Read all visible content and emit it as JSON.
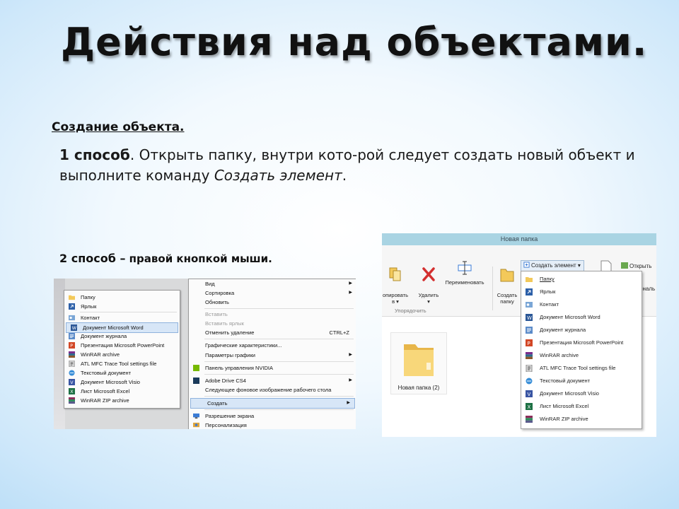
{
  "slide": {
    "title": "Действия над объектами.",
    "subheading": "Создание объекта.",
    "method1": {
      "lead": "1 способ",
      "text_a": ". Открыть папку, внутри кото-рой следует создать новый объект и выполните команду ",
      "emph": "Создать элемент",
      "text_b": "."
    },
    "method2": {
      "lead": "2 способ –",
      "rest": " правой кнопкой мыши."
    }
  },
  "desktop_menu": {
    "submenu_items": [
      {
        "label": "Папку",
        "icon": "folder-icon"
      },
      {
        "label": "Ярлык",
        "icon": "shortcut-icon"
      },
      {
        "label": "Контакт",
        "icon": "contact-icon"
      },
      {
        "label": "Документ Microsoft Word",
        "icon": "word-icon",
        "selected": true
      },
      {
        "label": "Документ журнала",
        "icon": "journal-icon"
      },
      {
        "label": "Презентация Microsoft PowerPoint",
        "icon": "powerpoint-icon"
      },
      {
        "label": "WinRAR archive",
        "icon": "winrar-icon"
      },
      {
        "label": "ATL MFC Trace Tool settings file",
        "icon": "settings-file-icon"
      },
      {
        "label": "Текстовый документ",
        "icon": "text-document-icon"
      },
      {
        "label": "Документ Microsoft Visio",
        "icon": "visio-icon"
      },
      {
        "label": "Лист Microsoft Excel",
        "icon": "excel-icon"
      },
      {
        "label": "WinRAR ZIP archive",
        "icon": "winrar-zip-icon"
      }
    ],
    "context_items": {
      "view": "Вид",
      "sort": "Сортировка",
      "refresh": "Обновить",
      "paste": "Вставить",
      "paste_shortcut": "Вставить ярлык",
      "undo_delete": "Отменить удаление",
      "undo_shortcut": "CTRL+Z",
      "graphics_props": "Графические характеристики...",
      "graphics_params": "Параметры графики",
      "nvidia": "Панель управления NVIDIA",
      "adobe_drive": "Adobe Drive CS4",
      "next_bg": "Следующее фоновое изображение рабочего стола",
      "create": "Создать",
      "resolution": "Разрешение экрана",
      "personalize": "Персонализация"
    }
  },
  "explorer": {
    "window_title": "Новая папка",
    "ribbon": {
      "copy_to": "опировать\nв ▾",
      "delete": "Удалить\n▾",
      "rename": "Переименовать",
      "new_folder": "Создать\nпапку",
      "new_item": "Создать элемент ▾",
      "open": "Открыть",
      "open_partial": "ональ",
      "group_label": "Упорядочить"
    },
    "dropdown_items": [
      {
        "label": "Папку",
        "icon": "folder-icon"
      },
      {
        "label": "Ярлык",
        "icon": "shortcut-icon"
      },
      {
        "label": "Контакт",
        "icon": "contact-icon"
      },
      {
        "label": "Документ Microsoft Word",
        "icon": "word-icon"
      },
      {
        "label": "Документ журнала",
        "icon": "journal-icon"
      },
      {
        "label": "Презентация Microsoft PowerPoint",
        "icon": "powerpoint-icon"
      },
      {
        "label": "WinRAR archive",
        "icon": "winrar-icon"
      },
      {
        "label": "ATL MFC Trace Tool settings file",
        "icon": "settings-file-icon"
      },
      {
        "label": "Текстовый документ",
        "icon": "text-document-icon"
      },
      {
        "label": "Документ Microsoft Visio",
        "icon": "visio-icon"
      },
      {
        "label": "Лист Microsoft Excel",
        "icon": "excel-icon"
      },
      {
        "label": "WinRAR ZIP archive",
        "icon": "winrar-zip-icon"
      }
    ],
    "folder_label": "Новая папка (2)"
  },
  "colors": {
    "selection": "#d7e6f7",
    "titlebar": "#a9d4e3",
    "folder": "#f3c95a"
  }
}
